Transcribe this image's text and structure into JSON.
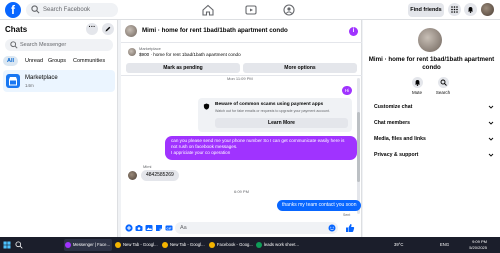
{
  "topbar": {
    "search_placeholder": "Search Facebook",
    "find_friends_label": "Find friends"
  },
  "sidebar": {
    "title": "Chats",
    "search_placeholder": "Search Messenger",
    "tabs": [
      {
        "label": "All",
        "active": true
      },
      {
        "label": "Unread",
        "active": false
      },
      {
        "label": "Groups",
        "active": false
      },
      {
        "label": "Communities",
        "active": false
      }
    ],
    "conversations": [
      {
        "name": "Marketplace",
        "subtitle": "14m"
      }
    ]
  },
  "conversation": {
    "title": "Mimi · home for rent 1bad/1bath apartment condo",
    "listing": {
      "source": "Marketplace",
      "description": "$900 · home for rent 1bad/1bath apartment condo",
      "mark_pending_label": "Mark as pending",
      "more_options_label": "More options"
    },
    "timestamp_1": "Mon 11:09 PM",
    "my_initials": "Hi",
    "scam_card": {
      "heading": "Beware of common scams using payment apps",
      "body": "Watch out for fake emails or requests to upgrade your payment account.",
      "learn_more_label": "Learn More"
    },
    "outgoing_message_1": [
      "can you please send me your phone number So I can get communicate easily here is",
      "not rush on facebook messages.",
      "I appriciate your co operation"
    ],
    "incoming_sender": "Mimi",
    "incoming_message": "4842585269",
    "timestamp_2": "6:09 PM",
    "outgoing_message_2": "thanks my team contact you soon",
    "sent_label": "Sent",
    "composer_placeholder": "Aa"
  },
  "details": {
    "title": "Mimi · home for rent 1bad/1bath apartment condo",
    "mute_label": "Mute",
    "search_label": "Search",
    "sections": [
      "Customize chat",
      "Chat members",
      "Media, files and links",
      "Privacy & support"
    ]
  },
  "taskbar": {
    "apps": [
      "Messenger | Face...",
      "New Tab - Googl...",
      "New Tab - Googl...",
      "Facebook - Goog...",
      "leads work sheet..."
    ],
    "weather": "39°C",
    "language": "ENG",
    "time": "9:09 PM",
    "date": "5/20/2025"
  },
  "colors": {
    "brand_blue": "#0866ff",
    "messenger_purple": "#a033ff",
    "selected_chat_bg": "#ebf5ff"
  }
}
